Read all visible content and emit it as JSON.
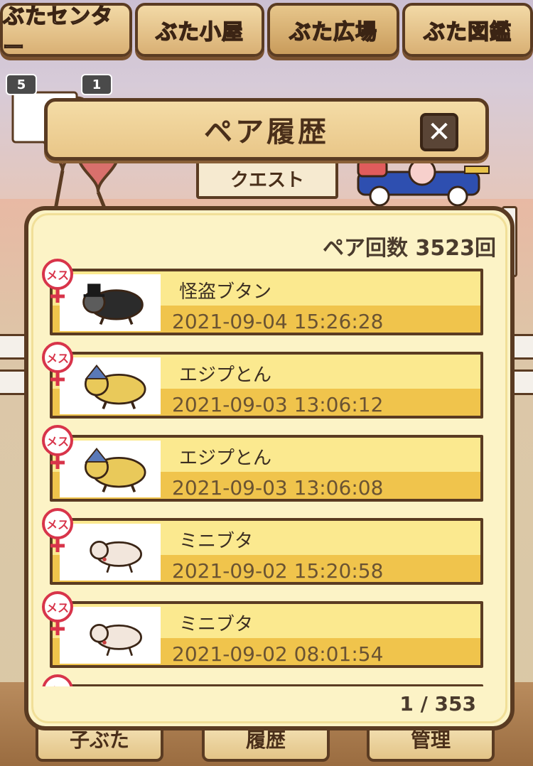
{
  "nav": {
    "tabs": [
      {
        "label": "ぶたセンター",
        "active": false
      },
      {
        "label": "ぶた小屋",
        "active": false
      },
      {
        "label": "ぶた広場",
        "active": true
      },
      {
        "label": "ぶた図鑑",
        "active": false
      }
    ]
  },
  "badges": [
    "5",
    "1"
  ],
  "background": {
    "quest_sign": "クエスト"
  },
  "dialog": {
    "title": "ペア履歴",
    "close_symbol": "✕",
    "pair_count": "ペア回数 3523回",
    "page_indicator": "1 / 353",
    "rows": [
      {
        "gender": "メス",
        "name": "怪盗ブタン",
        "date": "2021-09-04 15:26:28",
        "pig": "black"
      },
      {
        "gender": "メス",
        "name": "エジプとん",
        "date": "2021-09-03 13:06:12",
        "pig": "gold"
      },
      {
        "gender": "メス",
        "name": "エジプとん",
        "date": "2021-09-03 13:06:08",
        "pig": "gold"
      },
      {
        "gender": "メス",
        "name": "ミニブタ",
        "date": "2021-09-02 15:20:58",
        "pig": "pink"
      },
      {
        "gender": "メス",
        "name": "ミニブタ",
        "date": "2021-09-02 08:01:54",
        "pig": "pink"
      },
      {
        "gender": "メス",
        "name": "",
        "date": "",
        "pig": ""
      }
    ]
  },
  "bottom_buttons": [
    "子ぶた",
    "履歴",
    "管理"
  ],
  "colors": {
    "frame": "#5a3b22",
    "row_top": "#fbe98f",
    "row_bottom": "#f0c44c",
    "female": "#d8344a",
    "active_tab_text": "#ffe94a"
  }
}
